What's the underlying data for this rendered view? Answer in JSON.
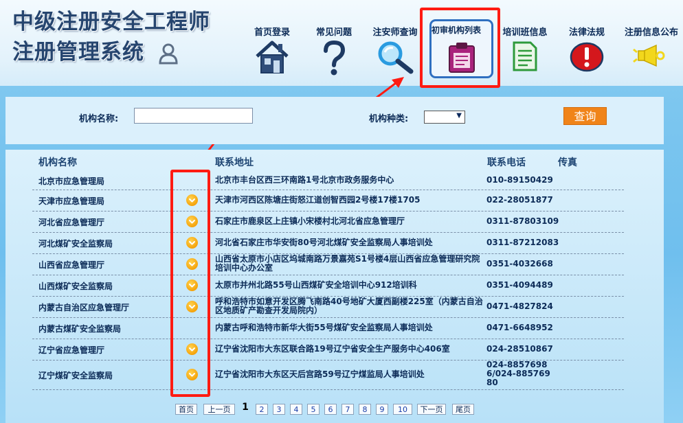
{
  "header": {
    "title_line1": "中级注册安全工程师",
    "title_line2": "注册管理系统"
  },
  "nav": {
    "items": [
      {
        "label": "首页登录",
        "icon": "house-icon"
      },
      {
        "label": "常见问题",
        "icon": "question-mark-icon"
      },
      {
        "label": "注安师查询",
        "icon": "magnifier-icon"
      },
      {
        "label": "初审机构列表",
        "icon": "clipboard-icon",
        "active": true
      },
      {
        "label": "培训班信息",
        "icon": "document-icon"
      },
      {
        "label": "法律法规",
        "icon": "warning-exclamation-icon"
      },
      {
        "label": "注册信息公布",
        "icon": "megaphone-icon"
      }
    ]
  },
  "search": {
    "name_label": "机构名称:",
    "name_value": "",
    "type_label": "机构种类:",
    "type_value": "",
    "query_label": "查询"
  },
  "table": {
    "headers": [
      "机构名称",
      "联系地址",
      "联系电话",
      "传真"
    ],
    "rows": [
      {
        "name": "北京市应急管理局",
        "badge": false,
        "address": "北京市丰台区西三环南路1号北京市政务服务中心",
        "phone": "010-89150429",
        "fax": ""
      },
      {
        "name": "天津市应急管理局",
        "badge": true,
        "address": "天津市河西区陈塘庄街怒江道创智西园2号楼17楼1705",
        "phone": "022-28051877",
        "fax": ""
      },
      {
        "name": "河北省应急管理厅",
        "badge": true,
        "address": "石家庄市鹿泉区上庄镇小宋楼村北河北省应急管理厅",
        "phone": "0311-87803109",
        "fax": ""
      },
      {
        "name": "河北煤矿安全监察局",
        "badge": true,
        "address": "河北省石家庄市华安街80号河北煤矿安全监察局人事培训处",
        "phone": "0311-87212083",
        "fax": ""
      },
      {
        "name": "山西省应急管理厅",
        "badge": true,
        "address": "山西省太原市小店区坞城南路万景嘉苑S1号楼4层山西省应急管理研究院培训中心办公室",
        "phone": "0351-4032668",
        "fax": ""
      },
      {
        "name": "山西煤矿安全监察局",
        "badge": true,
        "address": "太原市并州北路55号山西煤矿安全培训中心912培训科",
        "phone": "0351-4094489",
        "fax": ""
      },
      {
        "name": "内蒙古自治区应急管理厅",
        "badge": true,
        "address": "呼和浩特市如意开发区腾飞南路40号地矿大厦西副楼225室（内蒙古自治区地质矿产勘查开发局院内）",
        "phone": "0471-4827824",
        "fax": ""
      },
      {
        "name": "内蒙古煤矿安全监察局",
        "badge": false,
        "address": "内蒙古呼和浩特市新华大街55号煤矿安全监察局人事培训处",
        "phone": "0471-6648952",
        "fax": ""
      },
      {
        "name": "辽宁省应急管理厅",
        "badge": true,
        "address": "辽宁省沈阳市大东区联合路19号辽宁省安全生产服务中心406室",
        "phone": "024-28510867",
        "fax": ""
      },
      {
        "name": "辽宁煤矿安全监察局",
        "badge": true,
        "address": "辽宁省沈阳市大东区天后宫路59号辽宁煤监局人事培训处",
        "phone": "024-88576986/024-88576980",
        "fax": ""
      }
    ]
  },
  "pagination": {
    "first": "首页",
    "prev": "上一页",
    "current": "1",
    "pages": [
      "2",
      "3",
      "4",
      "5",
      "6",
      "7",
      "8",
      "9",
      "10"
    ],
    "next": "下一页",
    "last": "尾页"
  },
  "colors": {
    "highlight_border": "#ff1b12",
    "query_button": "#f08419",
    "badge": "#f5a30b",
    "active_nav_border": "#2f6fc0"
  }
}
